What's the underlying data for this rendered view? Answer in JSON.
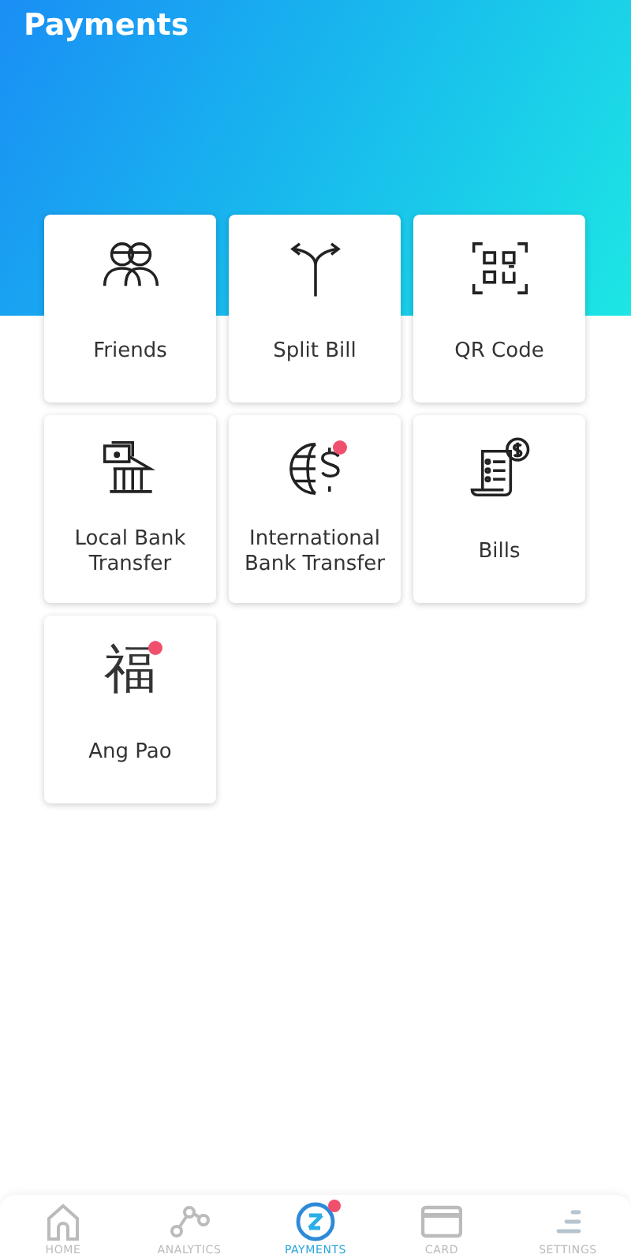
{
  "header": {
    "title": "Payments"
  },
  "tiles": [
    {
      "label": "Friends",
      "kind": "friends",
      "badge": false
    },
    {
      "label": "Split Bill",
      "kind": "split",
      "badge": false
    },
    {
      "label": "QR Code",
      "kind": "qr",
      "badge": false
    },
    {
      "label": "Local Bank\nTransfer",
      "kind": "bank",
      "badge": false
    },
    {
      "label": "International\nBank Transfer",
      "kind": "globe",
      "badge": true
    },
    {
      "label": "Bills",
      "kind": "bills",
      "badge": false
    },
    {
      "label": "Ang Pao",
      "kind": "glyph",
      "glyph": "福",
      "badge": true
    }
  ],
  "nav": [
    {
      "label": "HOME",
      "kind": "home",
      "selected": false,
      "badge": false
    },
    {
      "label": "ANALYTICS",
      "kind": "analytics",
      "selected": false,
      "badge": false
    },
    {
      "label": "PAYMENTS",
      "kind": "payments",
      "selected": true,
      "badge": true
    },
    {
      "label": "CARD",
      "kind": "card",
      "selected": false,
      "badge": false
    },
    {
      "label": "SETTINGS",
      "kind": "settings",
      "selected": false,
      "badge": false
    }
  ]
}
